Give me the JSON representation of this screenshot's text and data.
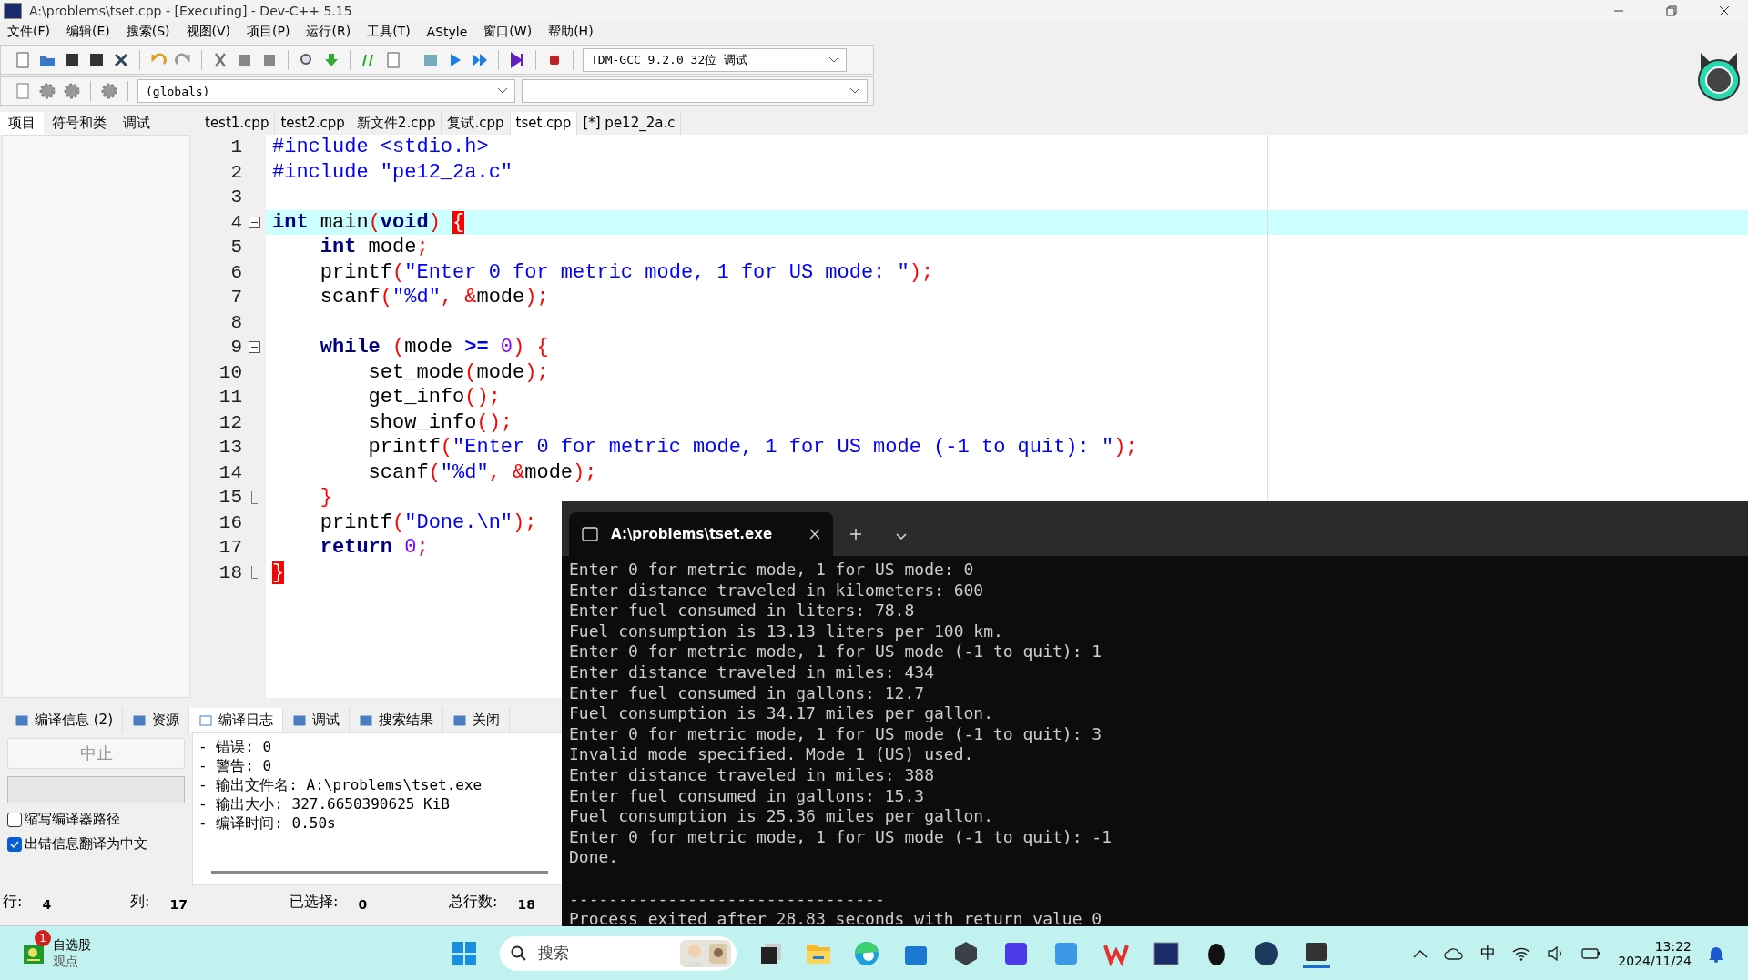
{
  "window": {
    "title": "A:\\problems\\tset.cpp - [Executing] - Dev-C++ 5.15"
  },
  "menu": [
    "文件(F)",
    "编辑(E)",
    "搜索(S)",
    "视图(V)",
    "项目(P)",
    "运行(R)",
    "工具(T)",
    "AStyle",
    "窗口(W)",
    "帮助(H)"
  ],
  "compiler_select": {
    "value": "TDM-GCC 9.2.0 32位 调试"
  },
  "scope_select": {
    "value": "(globals)"
  },
  "left_tabs": [
    {
      "label": "项目",
      "selected": true
    },
    {
      "label": "符号和类",
      "selected": false
    },
    {
      "label": "调试",
      "selected": false
    }
  ],
  "file_tabs": [
    {
      "label": "test1.cpp",
      "selected": false
    },
    {
      "label": "test2.cpp",
      "selected": false
    },
    {
      "label": "新文件2.cpp",
      "selected": false
    },
    {
      "label": "复试.cpp",
      "selected": false
    },
    {
      "label": "tset.cpp",
      "selected": true
    },
    {
      "label": "[*] pe12_2a.c",
      "selected": false
    }
  ],
  "editor": {
    "lines": [
      {
        "number": "1",
        "tokens": [
          {
            "text": "#include <stdio.h>",
            "kind": "pre"
          }
        ]
      },
      {
        "number": "2",
        "tokens": [
          {
            "text": "#include \"pe12_2a.c\"",
            "kind": "pre"
          }
        ]
      },
      {
        "number": "3"
      },
      {
        "number": "4",
        "current": true,
        "fold_start": true,
        "tokens": [
          {
            "text": "int",
            "kind": "kw"
          },
          {
            "text": " main",
            "kind": "id"
          },
          {
            "text": "(",
            "kind": "sym"
          },
          {
            "text": "void",
            "kind": "kw"
          },
          {
            "text": ") ",
            "kind": "sym"
          },
          {
            "text": "{",
            "kind": "match"
          }
        ]
      },
      {
        "number": "5",
        "tokens": [
          {
            "text": "    int",
            "kind": "kw"
          },
          {
            "text": " mode",
            "kind": "id"
          },
          {
            "text": ";",
            "kind": "sym"
          }
        ]
      },
      {
        "number": "6",
        "tokens": [
          {
            "text": "    printf",
            "kind": "id"
          },
          {
            "text": "(",
            "kind": "sym"
          },
          {
            "text": "\"Enter 0 for metric mode, 1 for US mode: \"",
            "kind": "str"
          },
          {
            "text": ");",
            "kind": "sym"
          }
        ]
      },
      {
        "number": "7",
        "tokens": [
          {
            "text": "    scanf",
            "kind": "id"
          },
          {
            "text": "(",
            "kind": "sym"
          },
          {
            "text": "\"%d\"",
            "kind": "str"
          },
          {
            "text": ", &",
            "kind": "sym"
          },
          {
            "text": "mode",
            "kind": "id"
          },
          {
            "text": ");",
            "kind": "sym"
          }
        ]
      },
      {
        "number": "8"
      },
      {
        "number": "9",
        "fold_start": true,
        "tokens": [
          {
            "text": "    while",
            "kind": "kw"
          },
          {
            "text": " (",
            "kind": "sym"
          },
          {
            "text": "mode ",
            "kind": "id"
          },
          {
            "text": ">=",
            "kind": "op"
          },
          {
            "text": " 0",
            "kind": "num"
          },
          {
            "text": ") {",
            "kind": "sym"
          }
        ]
      },
      {
        "number": "10",
        "tokens": [
          {
            "text": "        set_mode",
            "kind": "id"
          },
          {
            "text": "(",
            "kind": "sym"
          },
          {
            "text": "mode",
            "kind": "id"
          },
          {
            "text": ");",
            "kind": "sym"
          }
        ]
      },
      {
        "number": "11",
        "tokens": [
          {
            "text": "        get_info",
            "kind": "id"
          },
          {
            "text": "();",
            "kind": "sym"
          }
        ]
      },
      {
        "number": "12",
        "tokens": [
          {
            "text": "        show_info",
            "kind": "id"
          },
          {
            "text": "();",
            "kind": "sym"
          }
        ]
      },
      {
        "number": "13",
        "tokens": [
          {
            "text": "        printf",
            "kind": "id"
          },
          {
            "text": "(",
            "kind": "sym"
          },
          {
            "text": "\"Enter 0 for metric mode, 1 for US mode (-1 to quit): \"",
            "kind": "str"
          },
          {
            "text": ");",
            "kind": "sym"
          }
        ]
      },
      {
        "number": "14",
        "tokens": [
          {
            "text": "        scanf",
            "kind": "id"
          },
          {
            "text": "(",
            "kind": "sym"
          },
          {
            "text": "\"%d\"",
            "kind": "str"
          },
          {
            "text": ", &",
            "kind": "sym"
          },
          {
            "text": "mode",
            "kind": "id"
          },
          {
            "text": ");",
            "kind": "sym"
          }
        ]
      },
      {
        "number": "15",
        "fold_end": true,
        "tokens": [
          {
            "text": "    }",
            "kind": "sym"
          }
        ]
      },
      {
        "number": "16",
        "tokens": [
          {
            "text": "    printf",
            "kind": "id"
          },
          {
            "text": "(",
            "kind": "sym"
          },
          {
            "text": "\"Done.\\n\"",
            "kind": "str"
          },
          {
            "text": ");",
            "kind": "sym"
          }
        ]
      },
      {
        "number": "17",
        "tokens": [
          {
            "text": "    return",
            "kind": "kw"
          },
          {
            "text": " 0",
            "kind": "num"
          },
          {
            "text": ";",
            "kind": "sym"
          }
        ]
      },
      {
        "number": "18",
        "fold_end": true,
        "tokens": [
          {
            "text": "}",
            "kind": "match"
          }
        ]
      }
    ]
  },
  "bottom_tabs": [
    {
      "label": "编译信息 (2)",
      "selected": false
    },
    {
      "label": "资源",
      "selected": false
    },
    {
      "label": "编译日志",
      "selected": true
    },
    {
      "label": "调试",
      "selected": false
    },
    {
      "label": "搜索结果",
      "selected": false
    },
    {
      "label": "关闭",
      "selected": false
    }
  ],
  "compile_panel": {
    "abort_button": {
      "label": "中止",
      "disabled": true
    },
    "progress": {
      "level": 0
    },
    "options": [
      {
        "label": "缩写编译器路径",
        "checked": false
      },
      {
        "label": "出错信息翻译为中文",
        "checked": true
      }
    ],
    "log": [
      "- 错误: 0",
      "- 警告: 0",
      "- 输出文件名: A:\\problems\\tset.exe",
      "- 输出大小: 327.6650390625 KiB",
      "- 编译时间: 0.50s"
    ]
  },
  "status_bar": [
    {
      "label": "行:",
      "value": "4"
    },
    {
      "label": "列:",
      "value": "17"
    },
    {
      "label": "已选择:",
      "value": "0"
    },
    {
      "label": "总行数:",
      "value": "18"
    }
  ],
  "console": {
    "tab_title": "A:\\problems\\tset.exe",
    "lines": [
      {
        "text": "Enter 0 for metric mode, 1 for US mode: 0"
      },
      {
        "text": "Enter distance traveled in kilometers: 600"
      },
      {
        "text": "Enter fuel consumed in liters: 78.8"
      },
      {
        "text": "Fuel consumption is 13.13 liters per 100 km."
      },
      {
        "text": "Enter 0 for metric mode, 1 for US mode (-1 to quit): 1"
      },
      {
        "text": "Enter distance traveled in miles: 434"
      },
      {
        "text": "Enter fuel consumed in gallons: 12.7"
      },
      {
        "text": "Fuel consumption is 34.17 miles per gallon."
      },
      {
        "text": "Enter 0 for metric mode, 1 for US mode (-1 to quit): 3"
      },
      {
        "text": "Invalid mode specified. Mode 1 (US) used."
      },
      {
        "text": "Enter distance traveled in miles: 388"
      },
      {
        "text": "Enter fuel consumed in gallons: 15.3"
      },
      {
        "text": "Fuel consumption is 25.36 miles per gallon."
      },
      {
        "text": "Enter 0 for metric mode, 1 for US mode (-1 to quit): -1"
      },
      {
        "text": "Done."
      },
      {
        "text": "--------------------------------",
        "blank_before": true
      },
      {
        "text": "Process exited after 28.83 seconds with return value 0"
      }
    ]
  },
  "taskbar": {
    "widget": {
      "title": "自选股",
      "subtitle": "观点",
      "badge": "1"
    },
    "search": {
      "placeholder": "搜索"
    },
    "clock": {
      "time": "13:22",
      "date": "2024/11/24"
    },
    "ime": "中"
  }
}
